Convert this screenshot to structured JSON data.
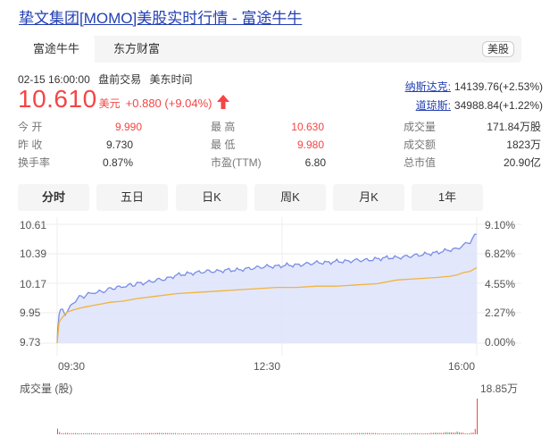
{
  "title": "挚文集团[MOMO]美股实时行情 - 富途牛牛",
  "source_tabs": [
    {
      "label": "富途牛牛"
    },
    {
      "label": "东方财富"
    }
  ],
  "market_badge": "美股",
  "timestamp": "02-15 16:00:00",
  "session": "盘前交易",
  "timezone": "美东时间",
  "price": "10.610",
  "currency": "美元",
  "change": "+0.880 (+9.04%)",
  "indices": [
    {
      "name": "纳斯达克:",
      "value": "14139.76(+2.53%)"
    },
    {
      "name": "道琼斯:",
      "value": "34988.84(+1.22%)"
    }
  ],
  "stats": {
    "open": {
      "label": "今  开",
      "value": "9.990"
    },
    "high": {
      "label": "最  高",
      "value": "10.630"
    },
    "volume": {
      "label": "成交量",
      "value": "171.84万股"
    },
    "prev": {
      "label": "昨  收",
      "value": "9.730"
    },
    "low": {
      "label": "最  低",
      "value": "9.980"
    },
    "amount": {
      "label": "成交额",
      "value": "1823万"
    },
    "turnover": {
      "label": "换手率",
      "value": "0.87%"
    },
    "pe": {
      "label": "市盈(TTM)",
      "value": "6.80"
    },
    "mktcap": {
      "label": "总市值",
      "value": "20.90亿"
    }
  },
  "periods": [
    {
      "label": "分时"
    },
    {
      "label": "五日"
    },
    {
      "label": "日K"
    },
    {
      "label": "周K"
    },
    {
      "label": "月K"
    },
    {
      "label": "1年"
    }
  ],
  "colors": {
    "up": "#f54545",
    "link": "#2440b3",
    "price_line": "#7a8ce6",
    "price_fill": "#dde3fb",
    "avg_line": "#f0b43c"
  },
  "chart_data": {
    "type": "line",
    "title": "",
    "ylabels_left": [
      "10.61",
      "10.39",
      "10.17",
      "9.95",
      "9.73"
    ],
    "ylabels_right": [
      "9.10%",
      "6.82%",
      "4.55%",
      "2.27%",
      "0.00%"
    ],
    "xlabels": [
      "09:30",
      "12:30",
      "16:00"
    ],
    "volume_label": "成交量 (股)",
    "volume_max_label": "18.85万",
    "ylim": [
      9.73,
      10.61
    ],
    "volume_max": 188500,
    "series": [
      {
        "name": "",
        "x": [
          0,
          1,
          3,
          5,
          8,
          12,
          16,
          20,
          25,
          30,
          40,
          50,
          60,
          70,
          80,
          90,
          100,
          110,
          120,
          135,
          150,
          165,
          180,
          195,
          210,
          225,
          240,
          255,
          270,
          285,
          300,
          315,
          330,
          345,
          360,
          375,
          390,
          405,
          420,
          435,
          450,
          465,
          480,
          495,
          510,
          525,
          540,
          555,
          570,
          585,
          600,
          610,
          620,
          630
        ],
        "values": [
          9.73,
          9.85,
          9.95,
          9.99,
          10.01,
          9.97,
          9.99,
          10.03,
          10.06,
          10.09,
          10.11,
          10.13,
          10.14,
          10.15,
          10.17,
          10.18,
          10.19,
          10.2,
          10.21,
          10.22,
          10.24,
          10.25,
          10.28,
          10.29,
          10.3,
          10.31,
          10.31,
          10.32,
          10.32,
          10.33,
          10.34,
          10.35,
          10.35,
          10.36,
          10.36,
          10.37,
          10.38,
          10.38,
          10.39,
          10.39,
          10.4,
          10.4,
          10.41,
          10.42,
          10.42,
          10.43,
          10.44,
          10.45,
          10.46,
          10.48,
          10.49,
          10.52,
          10.55,
          10.61
        ]
      },
      {
        "name": "",
        "x": [
          0,
          3,
          8,
          15,
          25,
          40,
          60,
          80,
          100,
          120,
          150,
          180,
          210,
          240,
          270,
          300,
          330,
          360,
          390,
          420,
          450,
          480,
          510,
          540,
          570,
          590,
          600,
          610,
          620,
          630
        ],
        "values": [
          9.73,
          9.9,
          9.94,
          9.98,
          10.0,
          10.02,
          10.04,
          10.06,
          10.07,
          10.09,
          10.11,
          10.13,
          10.14,
          10.15,
          10.16,
          10.17,
          10.18,
          10.18,
          10.19,
          10.19,
          10.2,
          10.21,
          10.24,
          10.25,
          10.26,
          10.27,
          10.28,
          10.3,
          10.31,
          10.34
        ]
      }
    ],
    "volume": {
      "x": [
        0,
        5,
        15,
        30,
        60,
        90,
        120,
        180,
        240,
        300,
        360,
        400,
        440,
        480,
        520,
        540,
        560,
        580,
        600,
        610,
        620,
        626,
        630
      ],
      "values": [
        30000,
        12000,
        8000,
        6000,
        5000,
        4000,
        7000,
        3000,
        5000,
        4000,
        6000,
        3000,
        7000,
        5000,
        9000,
        6000,
        8000,
        12000,
        15000,
        10000,
        22000,
        60000,
        188500
      ]
    }
  }
}
